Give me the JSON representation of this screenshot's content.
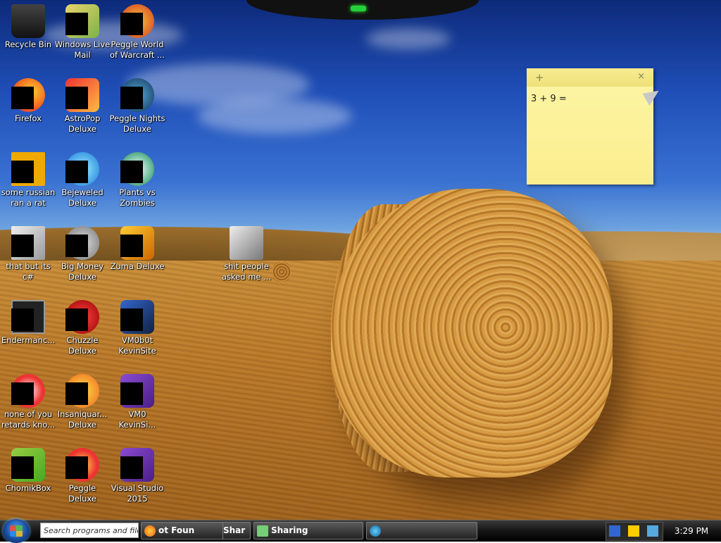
{
  "desktop": {
    "icons": [
      {
        "label": "Recycle Bin",
        "icon": "recycle-bin-icon"
      },
      {
        "label": "Windows Live Mail",
        "icon": "mail-icon"
      },
      {
        "label": "Peggle World of Warcraft ...",
        "icon": "peggle-wow-icon"
      },
      {
        "label": "Firefox",
        "icon": "firefox-icon"
      },
      {
        "label": "AstroPop Deluxe",
        "icon": "astropop-icon"
      },
      {
        "label": "Peggle Nights Deluxe",
        "icon": "peggle-nights-icon"
      },
      {
        "label": "some russian ran a rat",
        "icon": "app-icon"
      },
      {
        "label": "Bejeweled Deluxe",
        "icon": "bejeweled-icon"
      },
      {
        "label": "Plants vs Zombies",
        "icon": "plants-vs-zombies-icon"
      },
      {
        "label": "that but its c#",
        "icon": "copy-icon"
      },
      {
        "label": "Big Money Deluxe",
        "icon": "big-money-icon"
      },
      {
        "label": "Zuma Deluxe",
        "icon": "zuma-icon"
      },
      {
        "label": "Endermanc...",
        "icon": "terminal-icon"
      },
      {
        "label": "Chuzzle Deluxe",
        "icon": "chuzzle-icon"
      },
      {
        "label": "VM0b0t KevinSite",
        "icon": "vm-icon"
      },
      {
        "label": "none of you retards kno...",
        "icon": "peggle-icon"
      },
      {
        "label": "Insaniquar... Deluxe",
        "icon": "insaniquarium-icon"
      },
      {
        "label": "VM0 KevinSi...",
        "icon": "visual-studio-icon"
      },
      {
        "label": "ChomikBox",
        "icon": "chomikbox-icon"
      },
      {
        "label": "Peggle Deluxe",
        "icon": "peggle-deluxe-icon"
      },
      {
        "label": "Visual Studio 2015",
        "icon": "visual-studio-icon"
      },
      {
        "label": "shit people asked me ...",
        "icon": "folder-icon"
      }
    ]
  },
  "sticky_note": {
    "add": "+",
    "close": "×",
    "text": "3 + 9 ="
  },
  "taskbar": {
    "search_placeholder": "Search programs and files",
    "buttons": [
      {
        "label": "ot Foun"
      },
      {
        "label": "Shar"
      },
      {
        "label": "Sharing"
      },
      {
        "label": ""
      }
    ],
    "clock": "3:29 PM"
  },
  "colors": {
    "sticky_bg": "#fbee8e",
    "taskbar": "#151515",
    "accent": "#23d13a"
  }
}
